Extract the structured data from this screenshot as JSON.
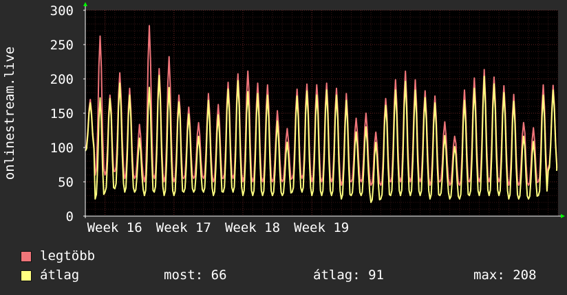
{
  "chart_data": {
    "type": "line",
    "ylabel": "onlinestream.live",
    "ylim": [
      0,
      300
    ],
    "yticks": [
      0,
      50,
      100,
      150,
      200,
      250,
      300
    ],
    "xlabels": [
      "Week 16",
      "Week 17",
      "Week 18",
      "Week 19"
    ],
    "grid": true,
    "legend_position": "bottom",
    "series": [
      {
        "name": "legtöbb",
        "color": "#f0757a",
        "day_peaks": [
          170,
          260,
          180,
          210,
          185,
          130,
          280,
          215,
          230,
          180,
          160,
          135,
          175,
          165,
          195,
          205,
          215,
          195,
          190,
          150,
          130,
          185,
          190,
          195,
          195,
          185,
          175,
          145,
          150,
          120,
          175,
          200,
          210,
          195,
          185,
          175,
          135,
          120,
          185,
          200,
          210,
          205,
          190,
          175,
          140,
          130,
          190,
          187
        ],
        "day_troughs": [
          100,
          60,
          60,
          65,
          55,
          55,
          50,
          55,
          50,
          50,
          55,
          55,
          55,
          50,
          55,
          55,
          50,
          50,
          50,
          50,
          50,
          55,
          55,
          50,
          50,
          50,
          45,
          50,
          50,
          45,
          45,
          50,
          50,
          50,
          50,
          45,
          50,
          45,
          45,
          50,
          50,
          50,
          50,
          45,
          45,
          45,
          50,
          70
        ]
      },
      {
        "name": "átlag",
        "color": "#ffff80",
        "day_peaks": [
          165,
          170,
          175,
          195,
          175,
          110,
          190,
          205,
          185,
          170,
          150,
          115,
          165,
          150,
          185,
          195,
          185,
          180,
          175,
          135,
          110,
          175,
          180,
          180,
          185,
          175,
          165,
          125,
          130,
          105,
          165,
          185,
          195,
          180,
          175,
          165,
          115,
          105,
          170,
          185,
          200,
          195,
          180,
          165,
          120,
          110,
          175,
          180
        ],
        "day_troughs": [
          95,
          25,
          35,
          40,
          35,
          35,
          30,
          35,
          30,
          30,
          35,
          35,
          35,
          30,
          35,
          35,
          30,
          30,
          30,
          30,
          30,
          35,
          35,
          30,
          30,
          30,
          25,
          30,
          30,
          20,
          25,
          30,
          30,
          30,
          30,
          25,
          30,
          25,
          25,
          30,
          30,
          30,
          30,
          25,
          25,
          25,
          30,
          66
        ]
      }
    ]
  },
  "legend": {
    "max_label": "legtöbb",
    "avg_label": "átlag",
    "stats": {
      "current": "most: 66",
      "average": "átlag: 91",
      "maximum": "max: 208"
    }
  }
}
